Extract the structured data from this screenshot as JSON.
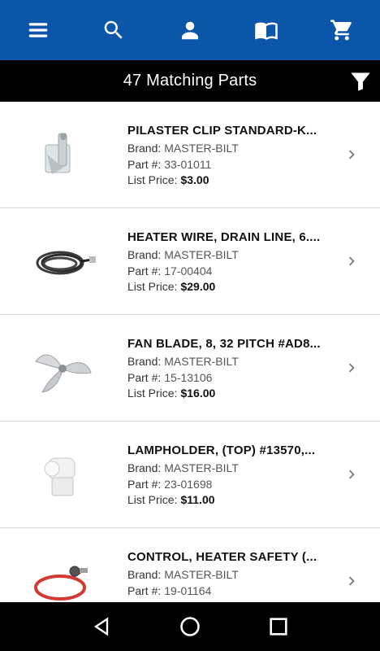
{
  "header": {
    "icons": [
      "menu-icon",
      "search-icon",
      "account-icon",
      "catalog-icon",
      "cart-icon"
    ]
  },
  "results": {
    "count_text": "47 Matching Parts",
    "filter_icon": "filter-icon"
  },
  "labels": {
    "brand": "Brand:",
    "part": "Part #:",
    "price": "List Price:"
  },
  "items": [
    {
      "title": "PILASTER CLIP STANDARD-K...",
      "brand": "MASTER-BILT",
      "part": "33-01011",
      "price": "$3.00",
      "image": "pilaster-clip-image"
    },
    {
      "title": "HEATER WIRE, DRAIN LINE, 6....",
      "brand": "MASTER-BILT",
      "part": "17-00404",
      "price": "$29.00",
      "image": "heater-wire-image"
    },
    {
      "title": "FAN BLADE, 8, 32 PITCH #AD8...",
      "brand": "MASTER-BILT",
      "part": "15-13106",
      "price": "$16.00",
      "image": "fan-blade-image"
    },
    {
      "title": "LAMPHOLDER, (TOP) #13570,...",
      "brand": "MASTER-BILT",
      "part": "23-01698",
      "price": "$11.00",
      "image": "lampholder-image"
    },
    {
      "title": "CONTROL, HEATER SAFETY (...",
      "brand": "MASTER-BILT",
      "part": "19-01164",
      "price": "",
      "image": "heater-control-image"
    }
  ],
  "system_nav": [
    "back-icon",
    "home-icon",
    "recents-icon"
  ],
  "colors": {
    "header": "#0b56a8",
    "bar": "#000000",
    "chevron": "#7a7a7a"
  }
}
